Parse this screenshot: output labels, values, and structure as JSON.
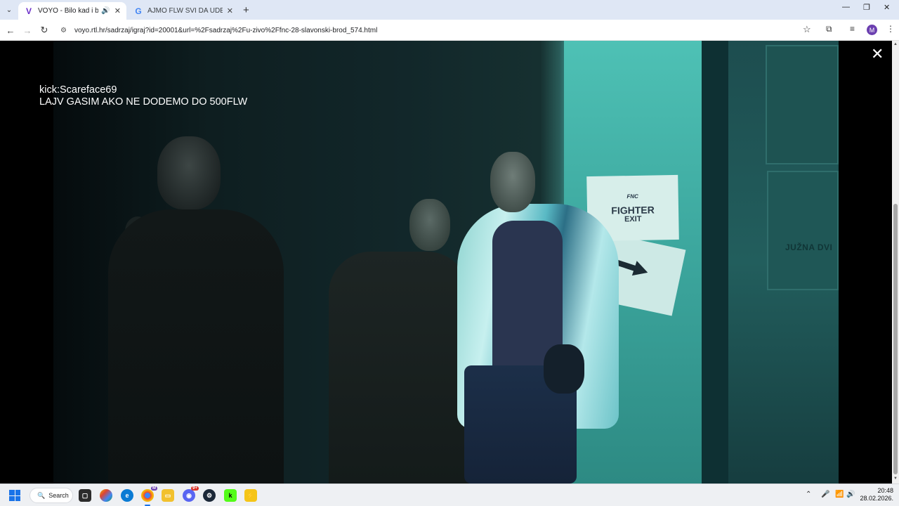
{
  "browser": {
    "tabs": [
      {
        "title": "VOYO - Bilo kad i bilo gdje",
        "favicon": "voyo-icon",
        "audio": true,
        "active": true
      },
      {
        "title": "AJMO FLW SVI DA UDEM U PR",
        "favicon": "google-icon",
        "active": false
      }
    ],
    "url": "voyo.rtl.hr/sadrzaj/igraj?id=20001&url=%2Fsadrzaj%2Fu-zivo%2Ffnc-28-slavonski-brod_574.html",
    "profile_initial": "M"
  },
  "video": {
    "overlay_line1": "kick:Scareface69",
    "overlay_line2": "LAJV GASIM AKO NE DODEMO DO 500FLW",
    "sign_brand": "FNC",
    "sign_line1": "FIGHTER",
    "sign_line2": "EXIT",
    "door_text": "JUŽNA DVI"
  },
  "taskbar": {
    "search_label": "Search",
    "discord_badge": "9+",
    "chrome_badge": "M",
    "time": "20:48",
    "date": "28.02.2026."
  },
  "colors": {
    "tabstrip": "#dfe7f5",
    "accent": "#1a73e8",
    "voyo": "#6b2fc9"
  }
}
